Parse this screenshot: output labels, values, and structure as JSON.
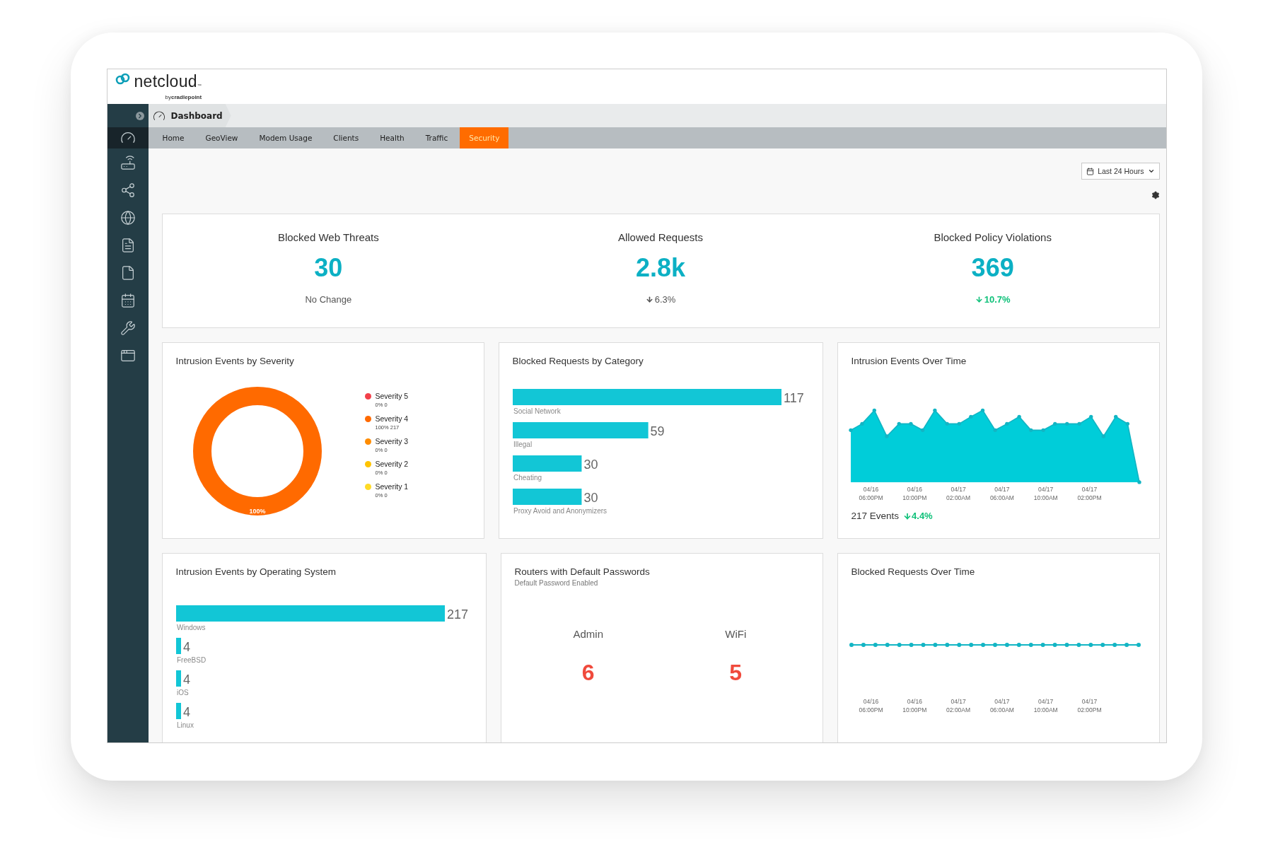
{
  "brand": {
    "name": "netcloud",
    "mark": "™",
    "byline": "by**cradlepoint**"
  },
  "sidebar": {
    "items": [
      {
        "kind": "gauge",
        "selected": true
      },
      {
        "kind": "router",
        "selected": false
      },
      {
        "kind": "share",
        "selected": false
      },
      {
        "kind": "globe",
        "selected": false
      },
      {
        "kind": "report",
        "selected": false
      },
      {
        "kind": "document",
        "selected": false
      },
      {
        "kind": "calendar",
        "selected": false
      },
      {
        "kind": "tools",
        "selected": false
      },
      {
        "kind": "apps",
        "selected": false
      }
    ]
  },
  "breadcrumb": "Dashboard",
  "tabs": [
    {
      "label": "Home",
      "selected": false
    },
    {
      "label": "GeoView",
      "selected": false
    },
    {
      "label": "Modem Usage",
      "selected": false
    },
    {
      "label": "Clients",
      "selected": false
    },
    {
      "label": "Health",
      "selected": false
    },
    {
      "label": "Traffic",
      "selected": false
    },
    {
      "label": "Security",
      "selected": true
    }
  ],
  "range_button": "Last 24 Hours",
  "kpis": [
    {
      "title": "Blocked Web Threats",
      "value": "30",
      "change": "No Change",
      "arrow": false,
      "highlight": false
    },
    {
      "title": "Allowed Requests",
      "value": "2.8k",
      "change": "6.3%",
      "arrow": true,
      "highlight": false
    },
    {
      "title": "Blocked Policy Violations",
      "value": "369",
      "change": "10.7%",
      "arrow": true,
      "highlight": true
    }
  ],
  "severity_panel": {
    "title": "Intrusion Events by Severity",
    "center_label": "100%",
    "legend": [
      {
        "name": "Severity 5",
        "detail": "0% 0",
        "color": "#f2404a",
        "level": 0
      },
      {
        "name": "Severity 4",
        "detail": "100% 217",
        "color": "#ff6a00",
        "level": 1
      },
      {
        "name": "Severity 3",
        "detail": "0% 0",
        "color": "#ff8c00",
        "level": 0
      },
      {
        "name": "Severity 2",
        "detail": "0% 0",
        "color": "#ffc400",
        "level": 0
      },
      {
        "name": "Severity 1",
        "detail": "0% 0",
        "color": "#ffdb26",
        "level": 0
      }
    ]
  },
  "category_panel": {
    "title": "Blocked Requests by Category",
    "chart_data": {
      "type": "bar",
      "orientation": "horizontal",
      "data_labels": true,
      "categories": [
        "Social Network",
        "Illegal",
        "Cheating",
        "Proxy Avoid and Anonymizers"
      ],
      "values": [
        117,
        59,
        30,
        30
      ]
    }
  },
  "events_panel": {
    "title": "Intrusion Events Over Time",
    "ticks": [
      {
        "date": "04/16",
        "time": "06:00PM"
      },
      {
        "date": "04/16",
        "time": "10:00PM"
      },
      {
        "date": "04/17",
        "time": "02:00AM"
      },
      {
        "date": "04/17",
        "time": "06:00AM"
      },
      {
        "date": "04/17",
        "time": "10:00AM"
      },
      {
        "date": "04/17",
        "time": "02:00PM"
      }
    ],
    "total": "217 Events",
    "change": "4.4%"
  },
  "os_panel": {
    "title": "Intrusion Events by Operating System",
    "chart_data": {
      "type": "bar",
      "orientation": "horizontal",
      "data_labels": true,
      "categories": [
        "Windows",
        "FreeBSD",
        "iOS",
        "Linux"
      ],
      "values": [
        217,
        4,
        4,
        4
      ]
    }
  },
  "passwords_panel": {
    "title": "Routers with Default Passwords",
    "subtitle": "Default Password Enabled",
    "items": [
      {
        "label": "Admin",
        "value": "6"
      },
      {
        "label": "WiFi",
        "value": "5"
      }
    ]
  },
  "requests_panel": {
    "title": "Blocked Requests Over Time",
    "ticks": [
      {
        "date": "04/16",
        "time": "06:00PM"
      },
      {
        "date": "04/16",
        "time": "10:00PM"
      },
      {
        "date": "04/17",
        "time": "02:00AM"
      },
      {
        "date": "04/17",
        "time": "06:00AM"
      },
      {
        "date": "04/17",
        "time": "10:00AM"
      },
      {
        "date": "04/17",
        "time": "02:00PM"
      }
    ]
  }
}
